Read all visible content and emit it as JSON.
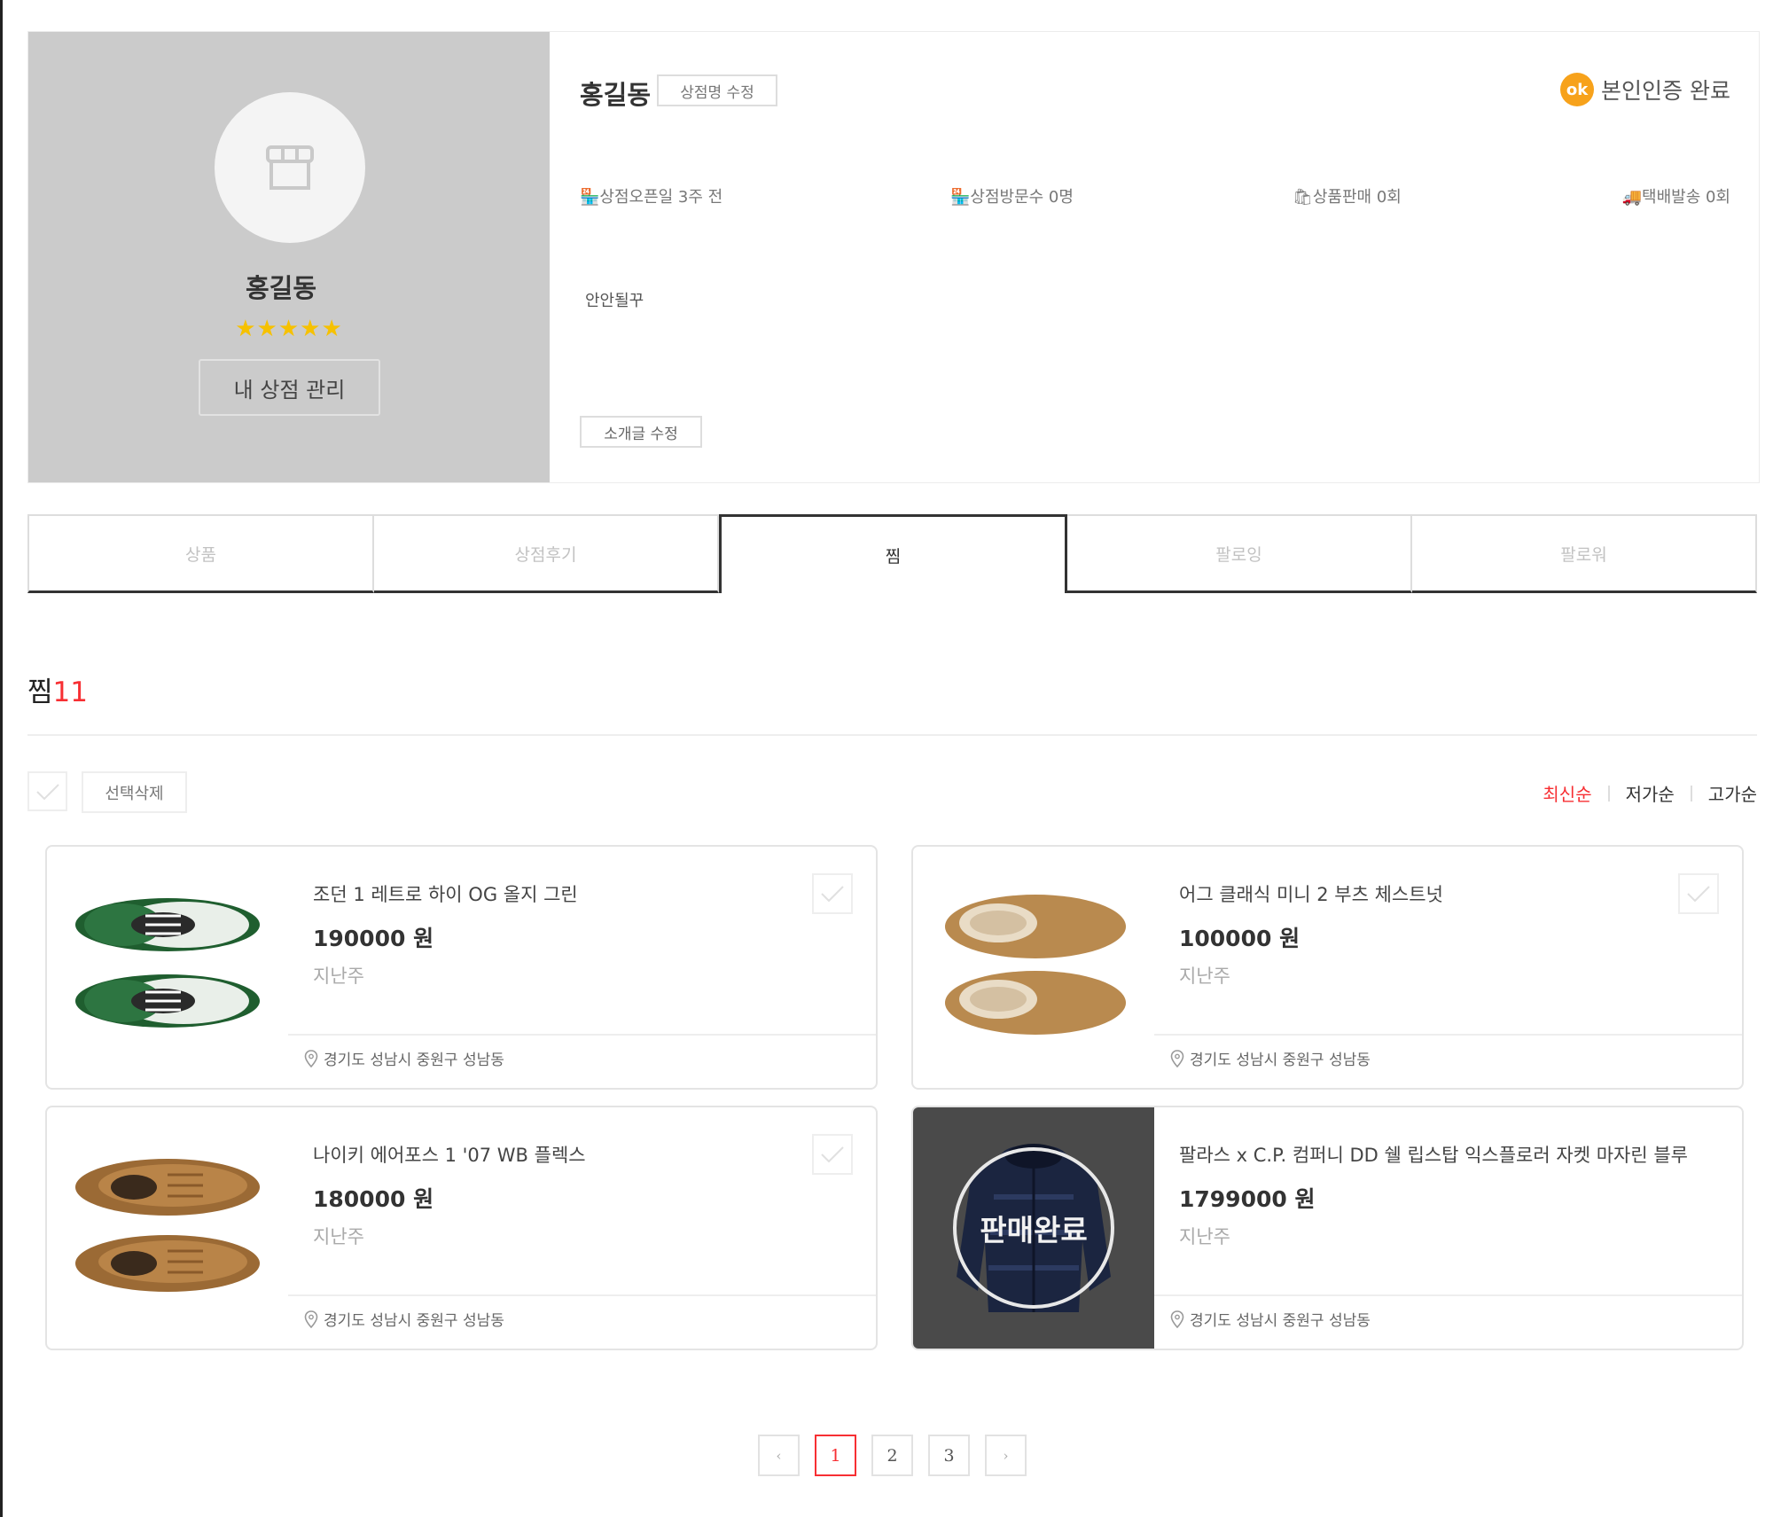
{
  "profile": {
    "name": "홍길동",
    "stars": "★★★★★",
    "manage_button": "내 상점 관리",
    "store_name": "홍길동",
    "edit_name_button": "상점명 수정",
    "verify_badge": "ok",
    "verify_text": "본인인증 완료",
    "stats": [
      "🏪상점오픈일 3주 전",
      "🏪상점방문수 0명",
      "🛍상품판매 0회",
      "🚚택배발송 0회"
    ],
    "intro": "안안될꾸",
    "edit_intro_button": "소개글 수정"
  },
  "tabs": [
    {
      "label": "상품",
      "active": false
    },
    {
      "label": "상점후기",
      "active": false
    },
    {
      "label": "찜",
      "active": true
    },
    {
      "label": "팔로잉",
      "active": false
    },
    {
      "label": "팔로워",
      "active": false
    }
  ],
  "section": {
    "title": "찜",
    "count": "11"
  },
  "toolbar": {
    "delete_selected": "선택삭제",
    "sort_options": [
      "최신순",
      "저가순",
      "고가순"
    ],
    "active_sort": "최신순"
  },
  "products": [
    {
      "title": "조던 1 레트로 하이 OG 올지 그린",
      "price": "190000 원",
      "time": "지난주",
      "location": "경기도 성남시 중원구 성남동",
      "image": "green-sneaker-image",
      "sold": false
    },
    {
      "title": "어그 클래식 미니 2 부츠 체스트넛",
      "price": "100000 원",
      "time": "지난주",
      "location": "경기도 성남시 중원구 성남동",
      "image": "chestnut-boot-image",
      "sold": false
    },
    {
      "title": "나이키 에어포스 1 '07 WB 플렉스",
      "price": "180000 원",
      "time": "지난주",
      "location": "경기도 성남시 중원구 성남동",
      "image": "wheat-sneaker-image",
      "sold": false
    },
    {
      "title": "팔라스 x C.P. 컴퍼니 DD 쉘 립스탑 익스플로러 자켓 마자린 블루",
      "price": "1799000 원",
      "time": "지난주",
      "location": "경기도 성남시 중원구 성남동",
      "image": "navy-puffer-jacket-image",
      "sold": true,
      "sold_label": "판매완료"
    }
  ],
  "pagination": {
    "prev": "‹",
    "pages": [
      "1",
      "2",
      "3"
    ],
    "current": "1",
    "next": "›"
  },
  "colors": {
    "accent": "#f72f33",
    "star": "#f6c100",
    "verify": "#f7a21b",
    "profile_bg": "#cbcbcb"
  }
}
